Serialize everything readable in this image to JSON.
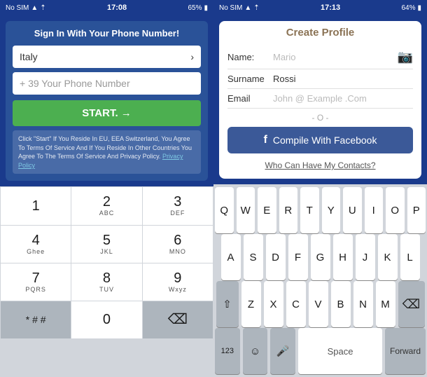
{
  "left": {
    "status": {
      "carrier": "No SIM",
      "time": "17:08",
      "battery": "65%"
    },
    "signin": {
      "title": "Sign In With Your Phone Number!",
      "country": "Italy",
      "phone_placeholder": "+ 39 Your Phone Number",
      "start_button": "START. →",
      "terms": "Click \"Start\" If You Reside In EU, EEA Switzerland, You Agree To Terms Of Service And If You Reside In Other Countries You Agree To The Terms Of Service And Privacy Policy.",
      "terms_link": "Privacy Policy"
    },
    "numpad": {
      "keys": [
        {
          "main": "1",
          "sub": ""
        },
        {
          "main": "2",
          "sub": "ABC"
        },
        {
          "main": "3",
          "sub": "DEF"
        },
        {
          "main": "4",
          "sub": "Ghee"
        },
        {
          "main": "5",
          "sub": "JKL"
        },
        {
          "main": "6",
          "sub": "MNO"
        },
        {
          "main": "7",
          "sub": "PQRS"
        },
        {
          "main": "8",
          "sub": "TUV"
        },
        {
          "main": "9",
          "sub": "Wxyz"
        },
        {
          "main": "* # #",
          "sub": ""
        },
        {
          "main": "0",
          "sub": ""
        },
        {
          "main": "⌫",
          "sub": ""
        }
      ]
    }
  },
  "right": {
    "status": {
      "carrier": "No SIM",
      "time": "17:13",
      "battery": "64%"
    },
    "create_profile": {
      "title": "Create Profile",
      "fields": [
        {
          "label": "Name:",
          "value": "Mario",
          "placeholder": true
        },
        {
          "label": "Surname",
          "value": "Rossi",
          "placeholder": false
        },
        {
          "label": "Email",
          "value": "John @ Example .Com",
          "placeholder": true
        }
      ],
      "divider": "- O -",
      "facebook_button": "Compile With Facebook",
      "contacts_link": "Who Can Have My Contacts?"
    },
    "keyboard": {
      "row1": [
        "Q",
        "W",
        "E",
        "R",
        "T",
        "Y",
        "U",
        "I",
        "O",
        "P"
      ],
      "row2": [
        "A",
        "S",
        "D",
        "F",
        "G",
        "H",
        "J",
        "K",
        "L"
      ],
      "row3": [
        "Z",
        "X",
        "C",
        "V",
        "B",
        "N",
        "M"
      ],
      "bottom": {
        "num_switch": "123",
        "emoji": "☺",
        "mic": "🎤",
        "space": "Space",
        "forward": "Forward",
        "delete": "⌫",
        "shift": "⇧"
      }
    }
  }
}
